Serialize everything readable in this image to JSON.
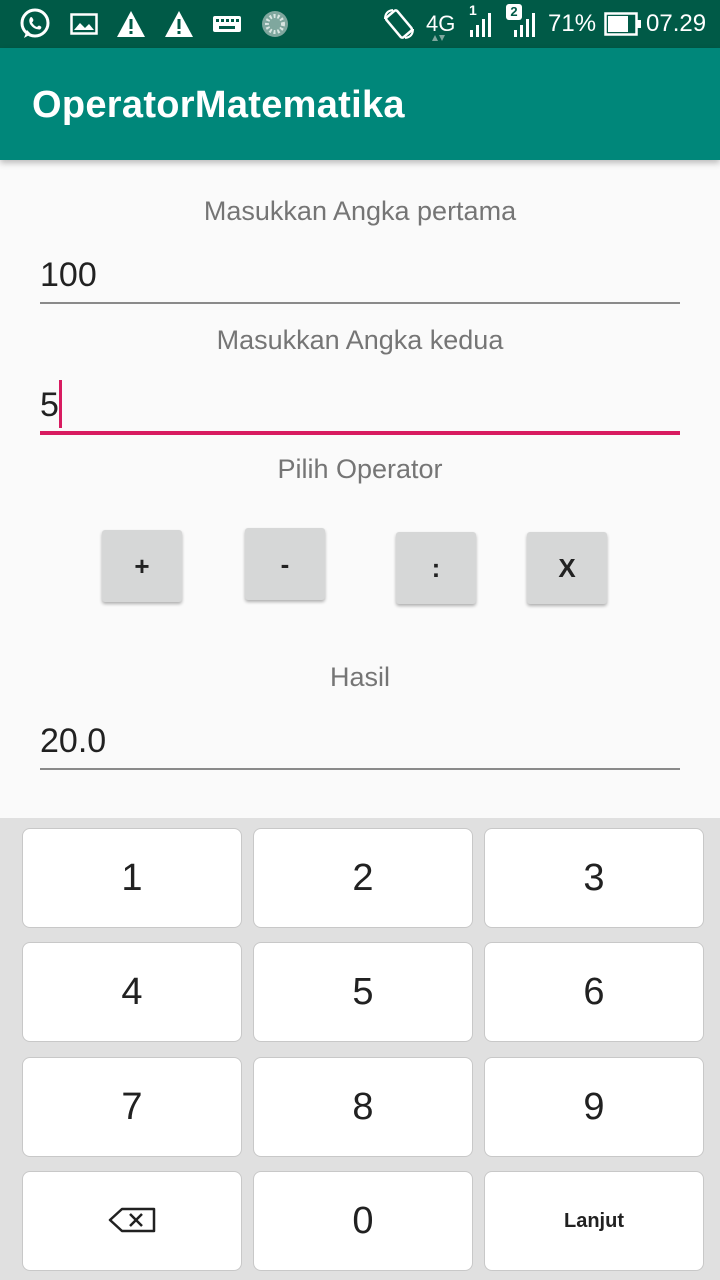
{
  "status_bar": {
    "icons": [
      "whatsapp-icon",
      "gallery-icon",
      "warning-icon",
      "warning-icon",
      "keyboard-icon",
      "loading-icon",
      "auto-rotate-icon",
      "signal-icon",
      "signal-icon",
      "battery-icon"
    ],
    "network": "4G",
    "sim1_badge": "1",
    "sim2_badge": "2",
    "battery": "71%",
    "time": "07.29",
    "background_color": "#005a47"
  },
  "app_bar": {
    "title": "OperatorMatematika",
    "background_color": "#00877a"
  },
  "form": {
    "first_label": "Masukkan Angka pertama",
    "first_value": "100",
    "second_label": "Masukkan Angka kedua",
    "second_value": "5",
    "operator_label": "Pilih Operator",
    "operators": {
      "add": "+",
      "subtract": "-",
      "divide": ":",
      "multiply": "X"
    },
    "result_label": "Hasil",
    "result_value": "20.0",
    "accent_color": "#d81b60"
  },
  "keyboard": {
    "keys": [
      "1",
      "2",
      "3",
      "4",
      "5",
      "6",
      "7",
      "8",
      "9",
      "0"
    ],
    "backspace_icon": "backspace-icon",
    "action": "Lanjut"
  }
}
